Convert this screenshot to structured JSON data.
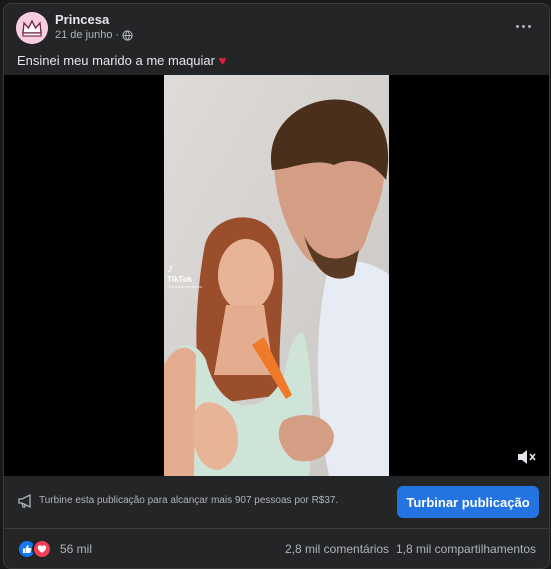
{
  "post": {
    "author": "Princesa",
    "date": "21 de junho",
    "separator": "·",
    "privacy_icon": "globe-icon",
    "caption": "Ensinei meu marido a me maquiar",
    "caption_emoji": "♥"
  },
  "video": {
    "watermark_brand": "TikTok",
    "watermark_handle": "@anamariabrakeno",
    "mute_icon": "speaker-muted-icon"
  },
  "boost": {
    "text": "Turbine esta publicação para alcançar mais 907 pessoas por R$37.",
    "button_label": "Turbinar publicação",
    "icon": "megaphone-icon"
  },
  "stats": {
    "reaction_count": "56 mil",
    "comments": "2,8 mil comentários",
    "shares": "1,8 mil compartilhamentos"
  },
  "colors": {
    "accent": "#2374e1",
    "like": "#1877f2",
    "love": "#f33e58",
    "card_bg": "#242526"
  }
}
